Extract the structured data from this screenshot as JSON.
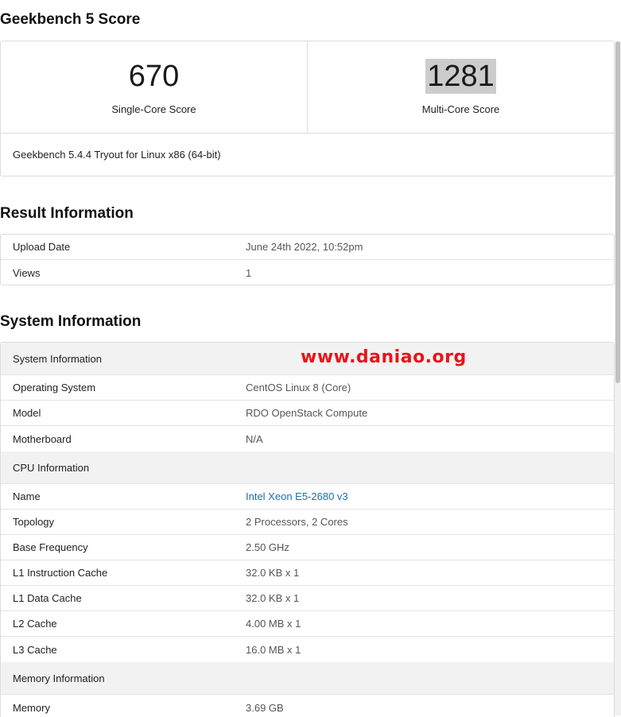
{
  "score_section": {
    "title": "Geekbench 5 Score",
    "single_core_value": "670",
    "single_core_label": "Single-Core Score",
    "multi_core_value": "1281",
    "multi_core_label": "Multi-Core Score",
    "version_text": "Geekbench 5.4.4 Tryout for Linux x86 (64-bit)"
  },
  "result_section": {
    "title": "Result Information",
    "rows": [
      {
        "label": "Upload Date",
        "value": "June 24th 2022, 10:52pm"
      },
      {
        "label": "Views",
        "value": "1"
      }
    ]
  },
  "system_section": {
    "title": "System Information",
    "watermark": "www.daniao.org",
    "groups": [
      {
        "heading": "System Information",
        "rows": [
          {
            "label": "Operating System",
            "value": "CentOS Linux 8 (Core)"
          },
          {
            "label": "Model",
            "value": "RDO OpenStack Compute"
          },
          {
            "label": "Motherboard",
            "value": "N/A"
          }
        ]
      },
      {
        "heading": "CPU Information",
        "rows": [
          {
            "label": "Name",
            "value": "Intel Xeon E5-2680 v3"
          },
          {
            "label": "Topology",
            "value": "2 Processors, 2 Cores"
          },
          {
            "label": "Base Frequency",
            "value": "2.50 GHz"
          },
          {
            "label": "L1 Instruction Cache",
            "value": "32.0 KB x 1"
          },
          {
            "label": "L1 Data Cache",
            "value": "32.0 KB x 1"
          },
          {
            "label": "L2 Cache",
            "value": "4.00 MB x 1"
          },
          {
            "label": "L3 Cache",
            "value": "16.0 MB x 1"
          }
        ]
      },
      {
        "heading": "Memory Information",
        "rows": [
          {
            "label": "Memory",
            "value": "3.69 GB"
          }
        ]
      }
    ]
  },
  "colors": {
    "link": "#1a6fa8",
    "watermark": "#e8141c",
    "group_background": "#f2f2f2",
    "highlight": "#cccccc"
  }
}
